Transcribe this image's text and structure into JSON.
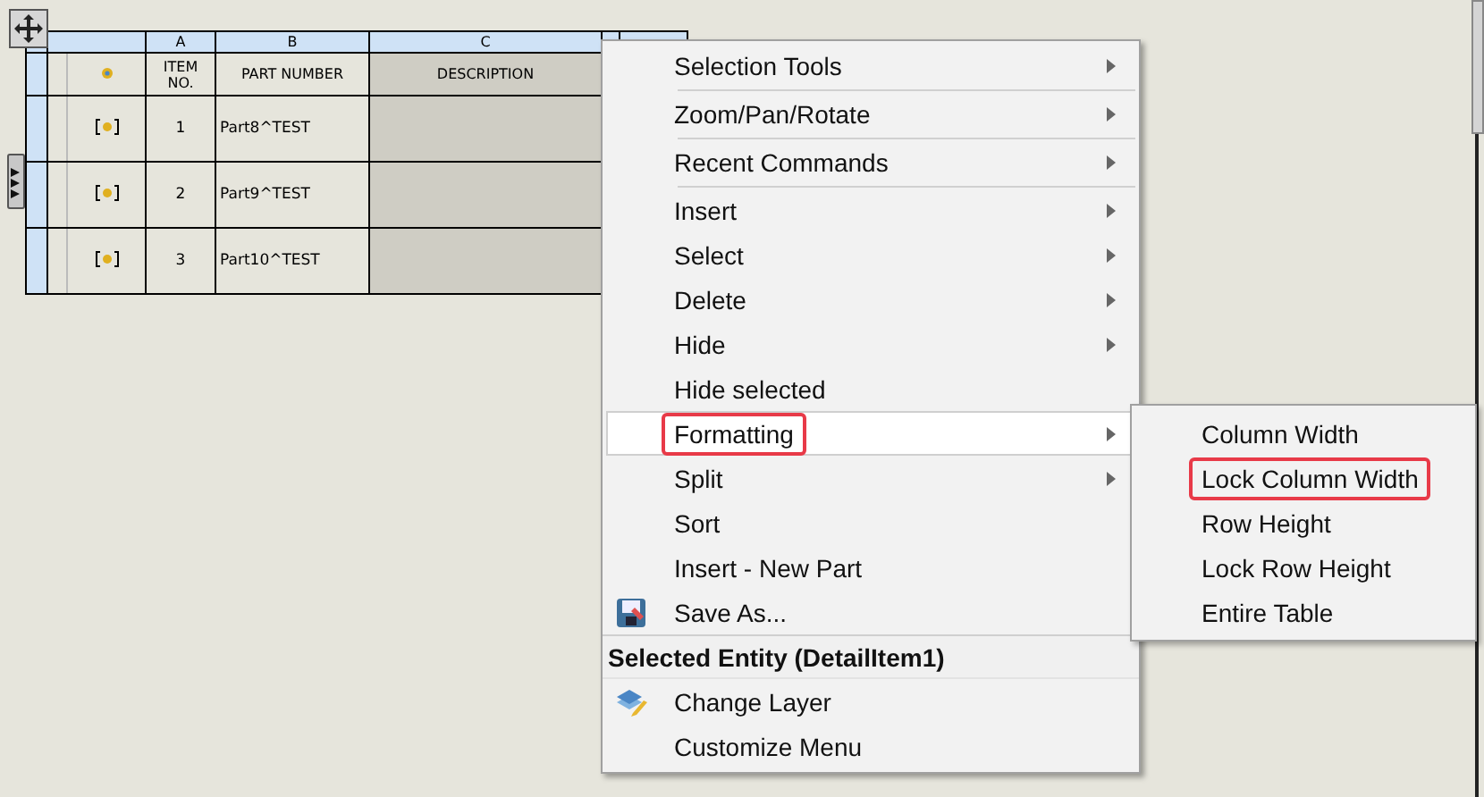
{
  "table": {
    "columns": [
      {
        "letter": "A",
        "heading": "ITEM NO."
      },
      {
        "letter": "B",
        "heading": "PART NUMBER"
      },
      {
        "letter": "C",
        "heading": "DESCRIPTION"
      }
    ],
    "rows": [
      {
        "item_no": "1",
        "part_number": "Part8^TEST"
      },
      {
        "item_no": "2",
        "part_number": "Part9^TEST"
      },
      {
        "item_no": "3",
        "part_number": "Part10^TEST"
      }
    ]
  },
  "menu": {
    "items": [
      {
        "kind": "item",
        "label": "Selection Tools",
        "submenu": true,
        "selected": false,
        "annotated": false,
        "separator_after": true
      },
      {
        "kind": "item",
        "label": "Zoom/Pan/Rotate",
        "submenu": true,
        "selected": false,
        "annotated": false,
        "separator_after": true
      },
      {
        "kind": "item",
        "label": "Recent Commands",
        "submenu": true,
        "selected": false,
        "annotated": false,
        "separator_after": true
      },
      {
        "kind": "item",
        "label": "Insert",
        "submenu": true,
        "selected": false,
        "annotated": false,
        "separator_after": false
      },
      {
        "kind": "item",
        "label": "Select",
        "submenu": true,
        "selected": false,
        "annotated": false,
        "separator_after": false
      },
      {
        "kind": "item",
        "label": "Delete",
        "submenu": true,
        "selected": false,
        "annotated": false,
        "separator_after": false
      },
      {
        "kind": "item",
        "label": "Hide",
        "submenu": true,
        "selected": false,
        "annotated": false,
        "separator_after": false
      },
      {
        "kind": "item",
        "label": "Hide selected",
        "submenu": false,
        "selected": false,
        "annotated": false,
        "separator_after": false
      },
      {
        "kind": "item",
        "label": "Formatting",
        "submenu": true,
        "selected": true,
        "annotated": true,
        "separator_after": false
      },
      {
        "kind": "item",
        "label": "Split",
        "submenu": true,
        "selected": false,
        "annotated": false,
        "separator_after": false
      },
      {
        "kind": "item",
        "label": "Sort",
        "submenu": false,
        "selected": false,
        "annotated": false,
        "separator_after": false
      },
      {
        "kind": "item",
        "label": "Insert - New Part",
        "submenu": false,
        "selected": false,
        "annotated": false,
        "separator_after": false
      },
      {
        "kind": "save",
        "label": "Save As...",
        "submenu": false,
        "selected": false,
        "annotated": false,
        "separator_after": false
      },
      {
        "kind": "header",
        "label": "Selected Entity (DetailItem1)"
      },
      {
        "kind": "layer",
        "label": "Change Layer",
        "submenu": false,
        "selected": false,
        "annotated": false,
        "separator_after": false
      },
      {
        "kind": "item",
        "label": "Customize Menu",
        "submenu": false,
        "selected": false,
        "annotated": false,
        "separator_after": false
      }
    ]
  },
  "submenu": {
    "items": [
      {
        "label": "Column Width",
        "annotated": false
      },
      {
        "label": "Lock Column Width",
        "annotated": true
      },
      {
        "label": "Row Height",
        "annotated": false
      },
      {
        "label": "Lock Row Height",
        "annotated": false
      },
      {
        "label": "Entire Table",
        "annotated": false
      }
    ]
  }
}
